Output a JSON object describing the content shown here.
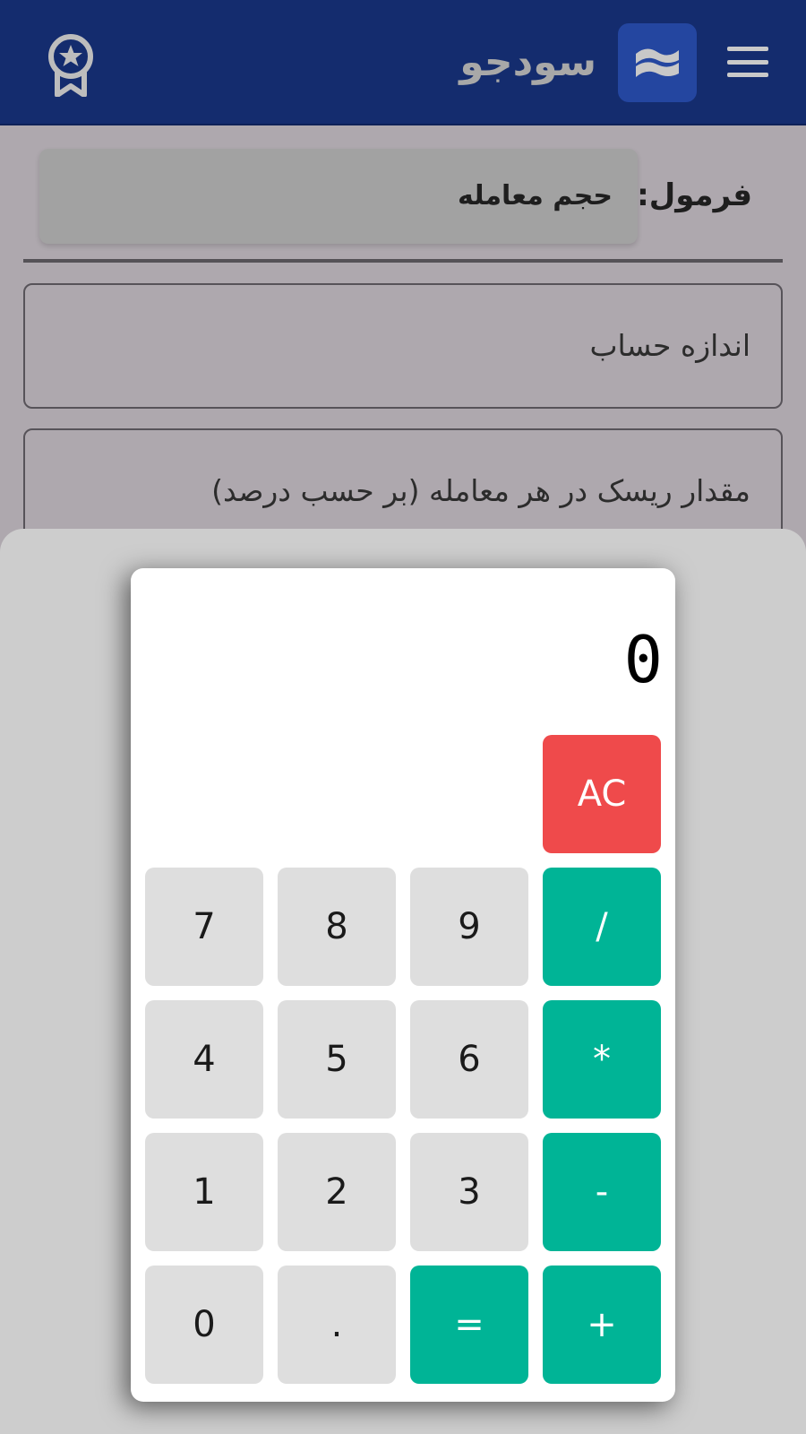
{
  "header": {
    "brand_name": "سودجو",
    "menu_icon": "hamburger-menu-icon",
    "logo_icon": "wave-logo-icon",
    "badge_icon": "award-badge-icon",
    "background_color": "#142c6e"
  },
  "form": {
    "formula_label": "فرمول:",
    "formula_value": "حجم معامله",
    "account_size_placeholder": "اندازه حساب",
    "risk_placeholder": "مقدار ریسک در هر معامله (بر حسب درصد)"
  },
  "calculator": {
    "display_value": "0",
    "clear_label": "AC",
    "keys": {
      "k7": "7",
      "k8": "8",
      "k9": "9",
      "divide": "/",
      "k4": "4",
      "k5": "5",
      "k6": "6",
      "multiply": "*",
      "k1": "1",
      "k2": "2",
      "k3": "3",
      "subtract": "-",
      "k0": "0",
      "decimal": ".",
      "equals": "=",
      "add": "+"
    },
    "colors": {
      "operator": "#00b496",
      "clear": "#ef4a4b",
      "number": "#dedede"
    }
  }
}
